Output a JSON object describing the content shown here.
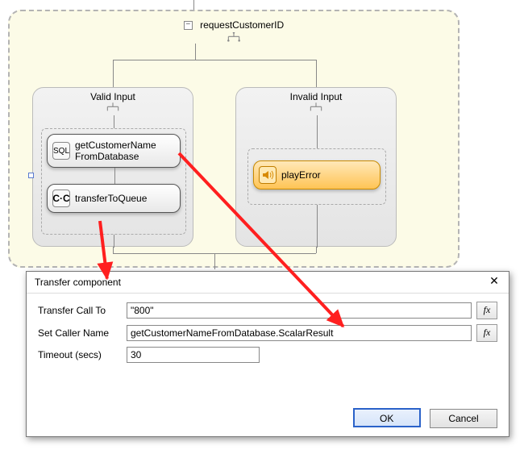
{
  "stage": {
    "title": "requestCustomerID",
    "valid": {
      "title": "Valid Input",
      "nodes": [
        {
          "label": "getCustomerName\nFromDatabase",
          "icon_name": "database-icon",
          "icon_text": "SQL"
        },
        {
          "label": "transferToQueue",
          "icon_name": "phone-transfer-icon",
          "icon_text": "↪☎"
        }
      ]
    },
    "invalid": {
      "title": "Invalid Input",
      "node": {
        "label": "playError",
        "icon_name": "speaker-icon"
      }
    }
  },
  "dialog": {
    "title": "Transfer component",
    "fields": {
      "transfer_label": "Transfer Call To",
      "transfer_value": "\"800\"",
      "caller_label": "Set Caller Name",
      "caller_value": "getCustomerNameFromDatabase.ScalarResult",
      "timeout_label": "Timeout (secs)",
      "timeout_value": "30"
    },
    "fx_label": "fx",
    "ok_label": "OK",
    "cancel_label": "Cancel"
  }
}
